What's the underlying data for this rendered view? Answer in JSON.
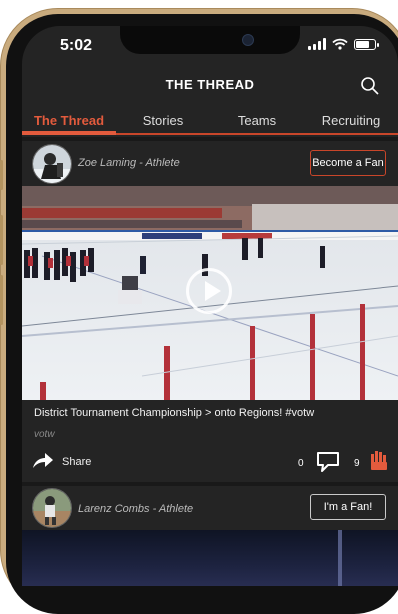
{
  "status_bar": {
    "time": "5:02"
  },
  "header": {
    "title": "THE THREAD"
  },
  "tabs": [
    {
      "label": "The Thread",
      "active": true
    },
    {
      "label": "Stories",
      "active": false
    },
    {
      "label": "Teams",
      "active": false
    },
    {
      "label": "Recruiting",
      "active": false
    }
  ],
  "posts": [
    {
      "author": "Zoe Laming - Athlete",
      "fan_button": "Become a Fan",
      "caption": "District Tournament Championship > onto Regions! #votw",
      "tag": "votw",
      "share_label": "Share",
      "comment_count": "0",
      "fan_count": "9"
    },
    {
      "author": "Larenz Combs - Athlete",
      "fan_button": "I'm a Fan!"
    }
  ],
  "colors": {
    "accent": "#e35b3d",
    "background": "#242424",
    "frame": "#c9ab7e"
  },
  "icons": [
    "search-icon",
    "play-icon",
    "share-icon",
    "comment-icon",
    "fan-hand-icon"
  ]
}
